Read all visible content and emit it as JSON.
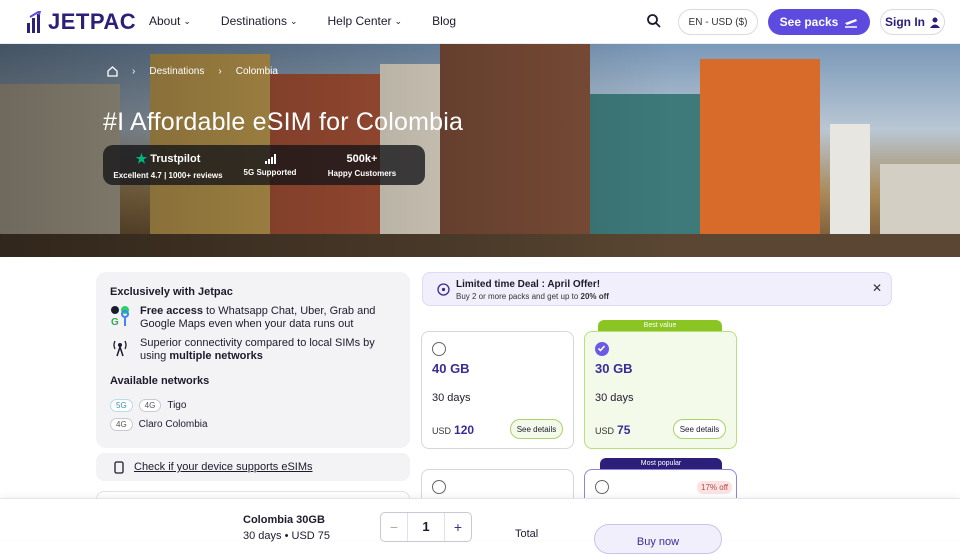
{
  "header": {
    "logo": "JETPAC",
    "nav": [
      {
        "label": "About",
        "has_dropdown": true
      },
      {
        "label": "Destinations",
        "has_dropdown": true
      },
      {
        "label": "Help Center",
        "has_dropdown": true
      },
      {
        "label": "Blog",
        "has_dropdown": false
      }
    ],
    "language_currency": "EN - USD ($)",
    "see_packs_label": "See packs",
    "sign_in_label": "Sign In"
  },
  "hero": {
    "breadcrumb": [
      "Destinations",
      "Colombia"
    ],
    "title": "#I Affordable eSIM for Colombia",
    "stats": [
      {
        "top": "Trustpilot",
        "bottom": "Excellent 4.7 | 1000+ reviews",
        "icon": "star-icon"
      },
      {
        "top": "",
        "bottom": "5G Supported",
        "icon": "signal-icon"
      },
      {
        "top": "500k+",
        "bottom": "Happy Customers"
      }
    ]
  },
  "exclusive": {
    "title": "Exclusively with Jetpac",
    "free_access_bold": "Free access",
    "free_access_rest": " to Whatsapp Chat, Uber, Grab and Google Maps even when your data runs out",
    "connectivity_text": "Superior connectivity compared to local SIMs by using ",
    "connectivity_bold": "multiple networks",
    "networks_title": "Available networks",
    "networks": [
      {
        "badges": [
          "5G",
          "4G"
        ],
        "name": "Tigo"
      },
      {
        "badges": [
          "4G"
        ],
        "name": "Claro Colombia"
      }
    ]
  },
  "device_check": "Check if your device supports eSIMs",
  "deal": {
    "title": "Limited time Deal : April Offer!",
    "text": "Buy 2 or more packs and get up to ",
    "bold": "20% off"
  },
  "packs": [
    {
      "data": "40 GB",
      "days": "30 days",
      "currency": "USD",
      "price": "120",
      "details": "See details",
      "selected": false,
      "tag": ""
    },
    {
      "data": "30 GB",
      "days": "30 days",
      "currency": "USD",
      "price": "75",
      "details": "See details",
      "selected": true,
      "tag": "Best value"
    },
    {
      "tag": "",
      "selected": false
    },
    {
      "tag": "Most popular",
      "selected": false,
      "discount": "17% off"
    }
  ],
  "footer": {
    "plan_name": "Colombia 30GB",
    "plan_days": "30 days",
    "plan_price": "USD 75",
    "quantity": "1",
    "minus": "−",
    "plus": "+",
    "total_label": "Total",
    "buy_label": "Buy now"
  },
  "colors": {
    "brand": "#2b1f7a",
    "accent": "#5d4be0",
    "best_value": "#8ac524",
    "most_popular": "#2b1f7a"
  }
}
